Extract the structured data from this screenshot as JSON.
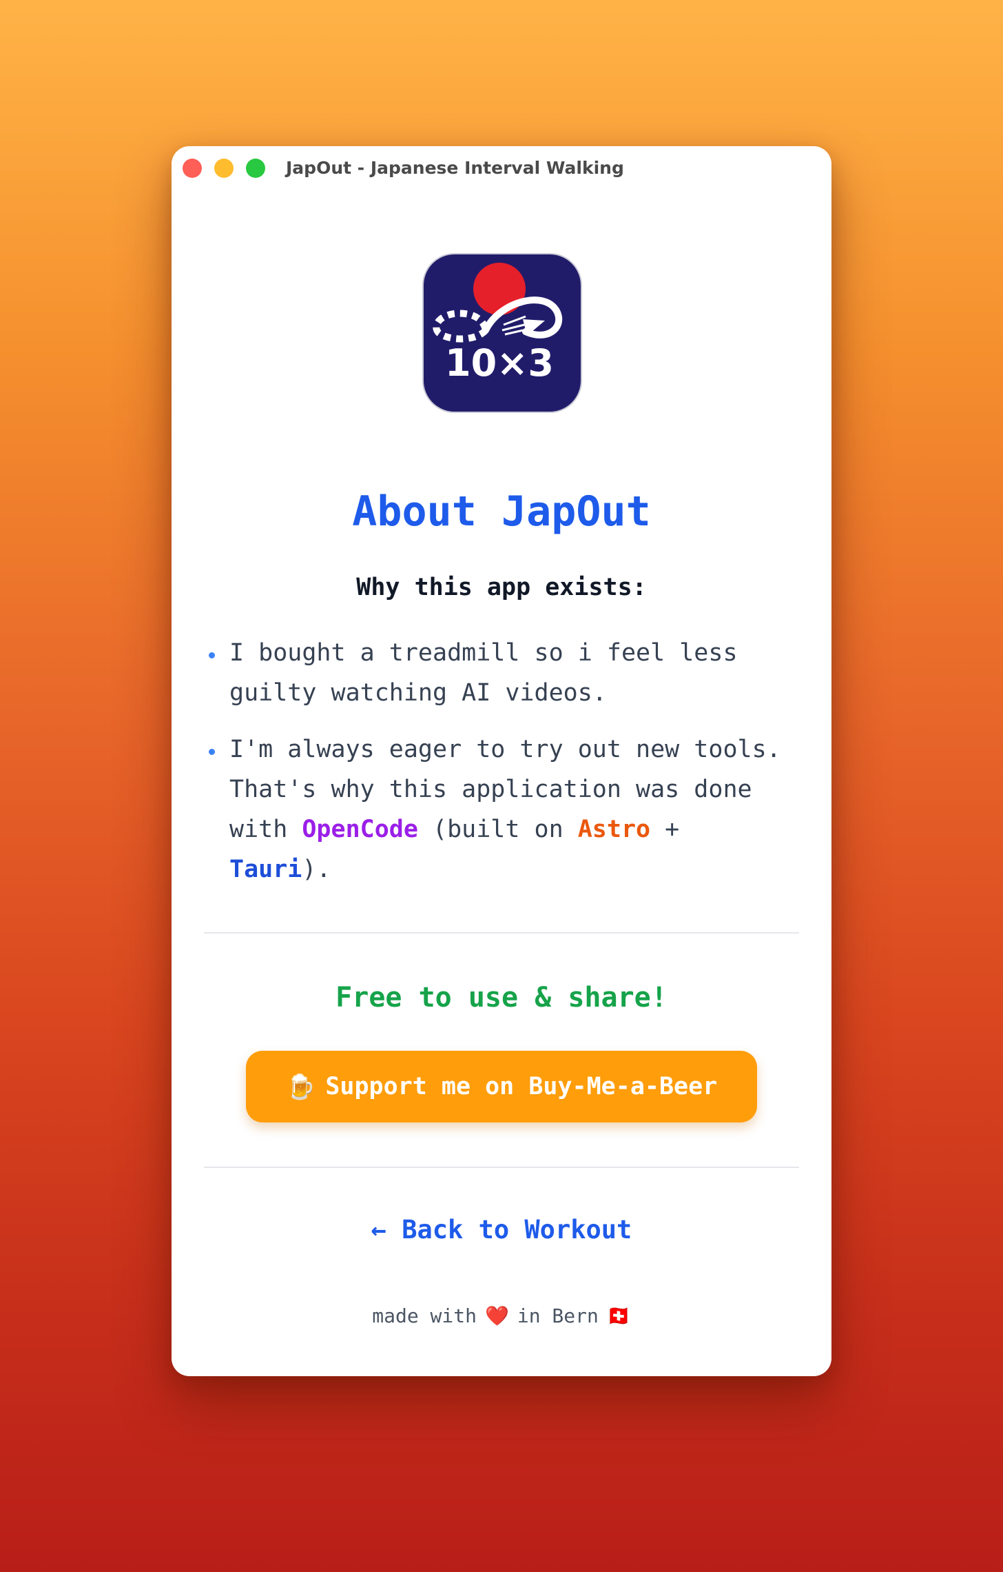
{
  "window": {
    "title": "JapOut - Japanese Interval Walking"
  },
  "app_icon": {
    "icon": "japout-app-icon",
    "label": "10×3",
    "colors": {
      "background": "#211c6a",
      "sun": "#e5202a",
      "path": "#ffffff"
    }
  },
  "about": {
    "title": "About JapOut",
    "why_title": "Why this app exists:",
    "bullet_1": "I bought a treadmill so i feel less guilty watching AI videos.",
    "bullet_2_prefix": "I'm always eager to try out new tools. That's why this application was done with ",
    "bullet_2_opencode": "OpenCode",
    "bullet_2_mid": " (built on ",
    "bullet_2_astro": "Astro",
    "bullet_2_plus": " + ",
    "bullet_2_tauri": "Tauri",
    "bullet_2_suffix": ")."
  },
  "free": {
    "text": "Free to use & share!"
  },
  "support": {
    "icon": "beer-mug-icon",
    "emoji": "🍺",
    "label": "Support me on Buy-Me-a-Beer"
  },
  "back": {
    "label": "← Back to Workout"
  },
  "footer": {
    "prefix": "made with",
    "heart": "❤️",
    "middle": "in Bern",
    "flag": "🇨🇭"
  },
  "colors": {
    "accent_blue": "#1e5bea",
    "green": "#16a34a",
    "orange_button": "#ff9d0a",
    "opencode_purple": "#9b1fe8",
    "astro_orange": "#ea580c",
    "tauri_blue": "#1d4ed8"
  }
}
